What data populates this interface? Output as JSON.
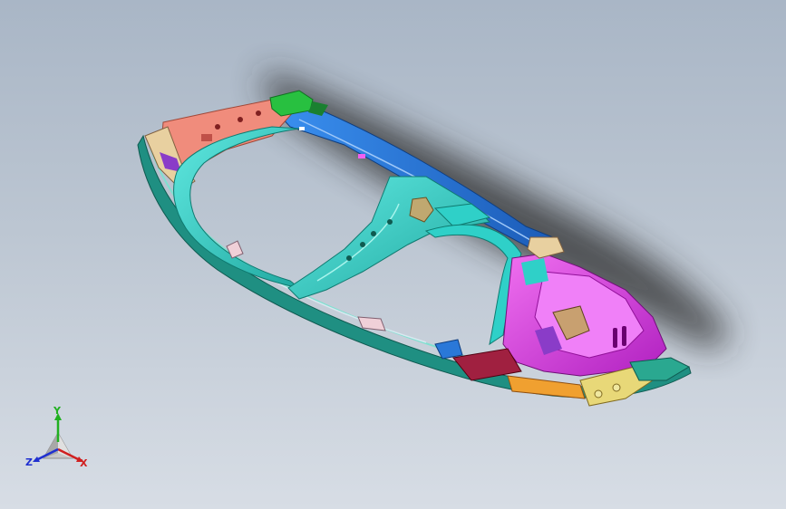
{
  "viewport": {
    "background_top": "#a9b6c6",
    "background_bottom": "#d7dde5"
  },
  "model": {
    "description_icon": "dashboard-crossmember-assembly-icon",
    "colors": {
      "cyan": "#2fd0c8",
      "teal": "#1f8f82",
      "blue": "#2a78d8",
      "salmon": "#f08c7c",
      "magenta": "#e040e0",
      "purple": "#8a3cc8",
      "orange": "#f0a030",
      "yellow": "#e8d878",
      "green": "#28c040",
      "dark_red": "#a02040"
    }
  },
  "triad": {
    "x_label": "X",
    "y_label": "Y",
    "z_label": "Z",
    "x_color": "#d02020",
    "y_color": "#20b020",
    "z_color": "#2030d0"
  }
}
